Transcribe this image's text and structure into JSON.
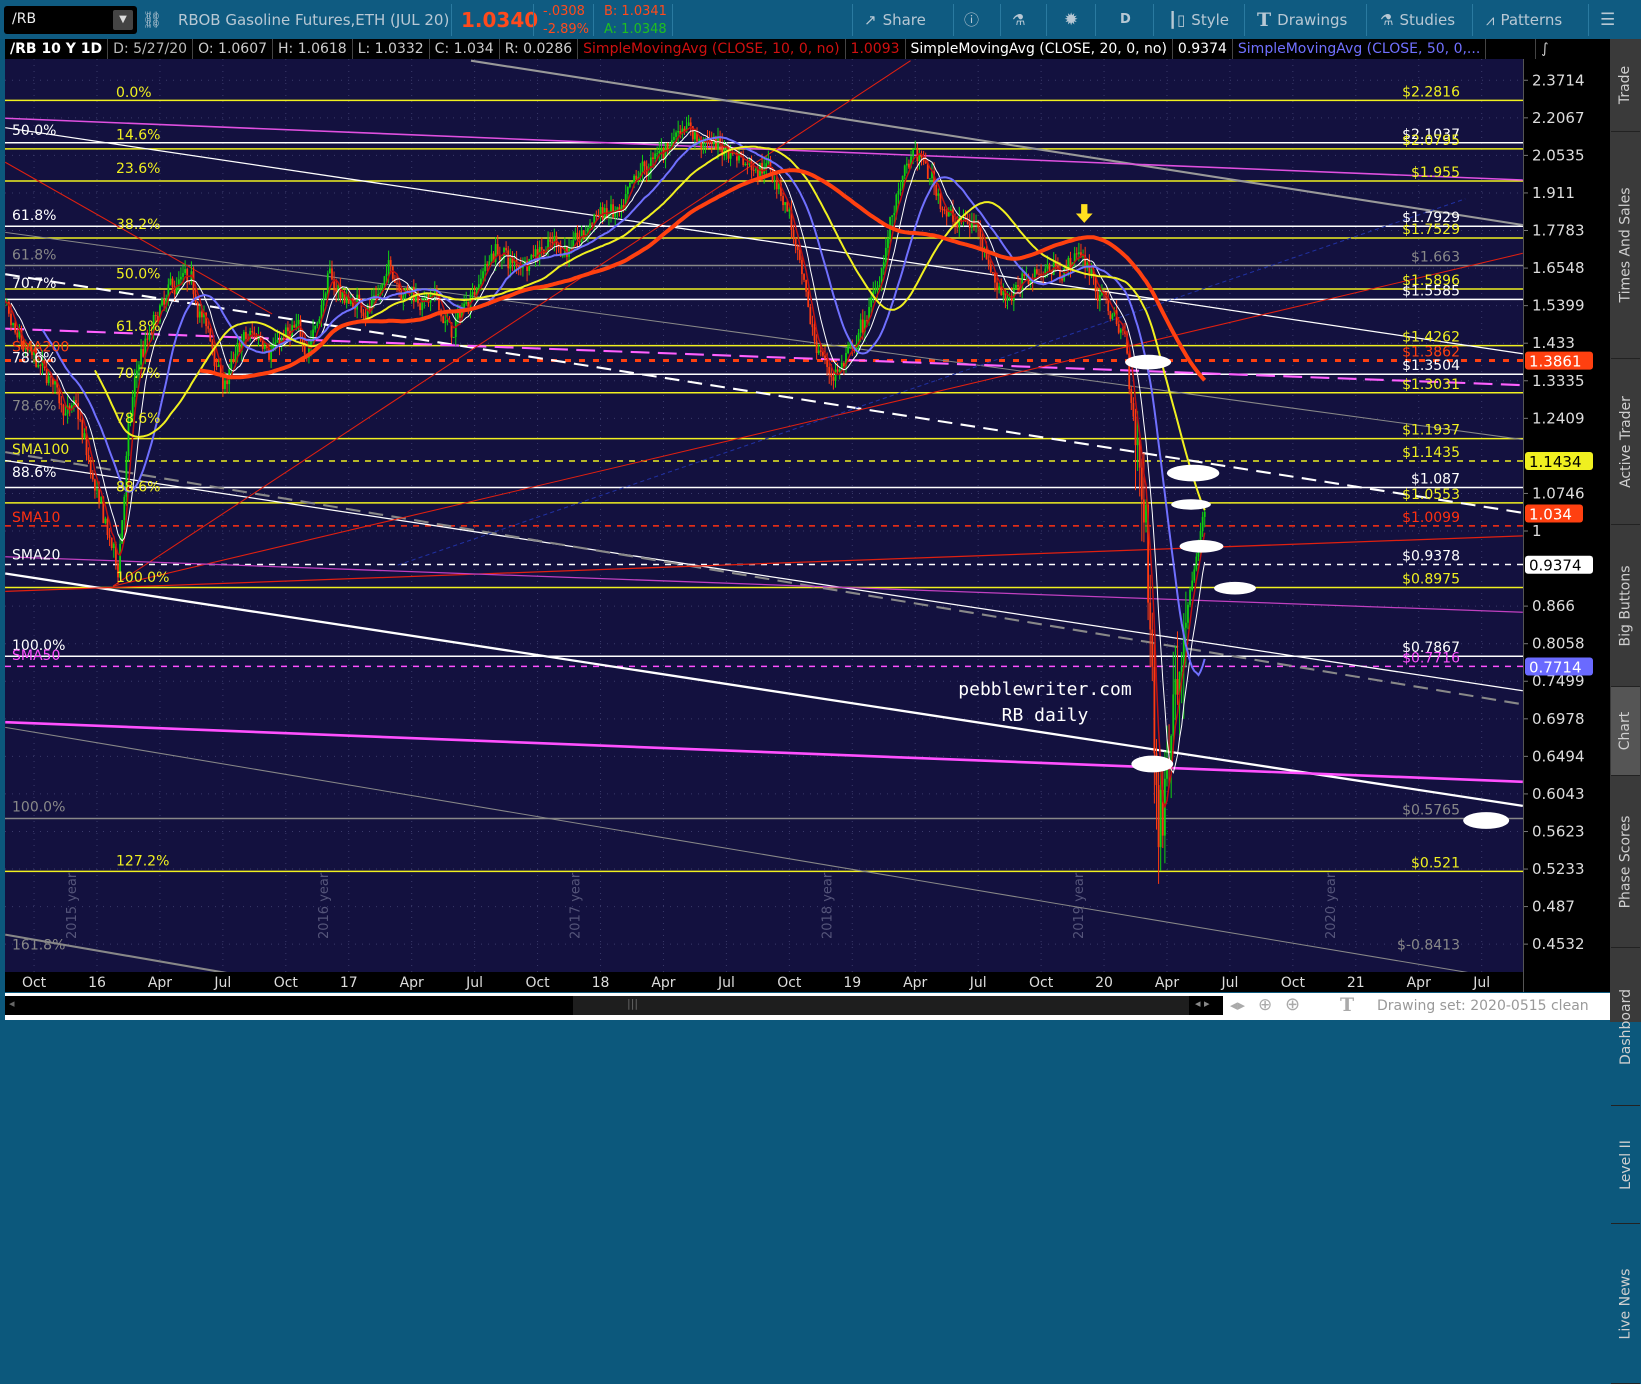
{
  "toolbar": {
    "symbol": "/RB",
    "description": "RBOB Gasoline Futures,ETH (JUL 20)",
    "last": "1.0340",
    "change": "-.0308",
    "change_pct": "-2.89%",
    "bid": "B: 1.0341",
    "ask": "A: 1.0348",
    "share": "Share",
    "aggregation": "D",
    "style": "Style",
    "drawings": "Drawings",
    "studies": "Studies",
    "patterns": "Patterns",
    "colors": {
      "bar": "#0f5b81",
      "last": "#ff4a1c",
      "bid": "#ff4a1c",
      "ask": "#1fc01f"
    }
  },
  "header": {
    "title": "/RB 10 Y 1D",
    "date": "D: 5/27/20",
    "open": "O: 1.0607",
    "high": "H: 1.0618",
    "low": "L: 1.0332",
    "close": "C: 1.034",
    "range": "R: 0.0286",
    "studies": [
      {
        "label": "SimpleMovingAvg (CLOSE, 10, 0, no)",
        "value": "1.0093",
        "color": "#d01010"
      },
      {
        "label": "SimpleMovingAvg (CLOSE, 20, 0, no)",
        "value": "0.9374",
        "color": "#ffffff"
      },
      {
        "label": "SimpleMovingAvg (CLOSE, 50, 0,...",
        "value": "",
        "color": "#7070ff"
      }
    ]
  },
  "sidebar": {
    "tabs": [
      "Trade",
      "Times And Sales",
      "Active Trader",
      "Big Buttons",
      "Chart",
      "Phase Scores",
      "Dashboard",
      "Level II",
      "Live News"
    ],
    "selected": "Chart"
  },
  "chart_data": {
    "type": "candlestick",
    "title": "/RB 10 Y 1D",
    "scale": "log",
    "ylim": [
      0.43,
      2.45
    ],
    "y_ticks": [
      "2.3714",
      "2.2067",
      "2.0535",
      "1.911",
      "1.7783",
      "1.6548",
      "1.5399",
      "1.433",
      "1.3335",
      "1.2409",
      "1.0746",
      "1",
      "0.866",
      "0.8058",
      "0.7499",
      "0.6978",
      "0.6494",
      "0.6043",
      "0.5623",
      "0.5233",
      "0.487",
      "0.4532"
    ],
    "x_ticks": [
      [
        "Oct",
        -3
      ],
      [
        "16",
        0
      ],
      [
        "Apr",
        3
      ],
      [
        "Jul",
        6
      ],
      [
        "Oct",
        9
      ],
      [
        "17",
        12
      ],
      [
        "Apr",
        15
      ],
      [
        "Jul",
        18
      ],
      [
        "Oct",
        21
      ],
      [
        "18",
        24
      ],
      [
        "Apr",
        27
      ],
      [
        "Jul",
        30
      ],
      [
        "Oct",
        33
      ],
      [
        "19",
        36
      ],
      [
        "Apr",
        39
      ],
      [
        "Jul",
        42
      ],
      [
        "Oct",
        45
      ],
      [
        "20",
        48
      ],
      [
        "Apr",
        51
      ],
      [
        "Jul",
        54
      ],
      [
        "Oct",
        57
      ],
      [
        "21",
        60
      ],
      [
        "Apr",
        63
      ],
      [
        "Jul",
        66
      ]
    ],
    "year_watermarks": [
      [
        "2015 year",
        -1
      ],
      [
        "2016 year",
        11
      ],
      [
        "2017 year",
        23
      ],
      [
        "2018 year",
        35
      ],
      [
        "2019 year",
        47
      ],
      [
        "2020 year",
        59
      ]
    ],
    "monthly_close_approx": {
      "months_from_jan2016": [
        -5,
        -4,
        -3,
        -2,
        -1,
        0,
        1,
        1.5,
        2,
        3,
        4,
        5,
        6,
        7,
        8,
        9,
        10,
        11,
        12,
        13,
        14,
        15,
        16,
        17,
        18,
        19,
        20,
        21,
        22,
        23,
        24,
        25,
        26,
        27,
        28,
        29,
        30,
        31,
        32,
        33,
        34,
        35,
        36,
        37,
        38,
        39,
        40,
        41,
        42,
        43,
        44,
        45,
        46,
        47,
        48,
        49,
        50,
        50.6,
        51,
        52,
        52.9
      ],
      "close": [
        1.6,
        1.42,
        1.35,
        1.3,
        1.25,
        1.05,
        0.92,
        1.2,
        1.38,
        1.5,
        1.6,
        1.5,
        1.32,
        1.42,
        1.45,
        1.45,
        1.42,
        1.62,
        1.55,
        1.55,
        1.65,
        1.6,
        1.55,
        1.45,
        1.62,
        1.72,
        1.65,
        1.75,
        1.75,
        1.72,
        1.85,
        1.8,
        1.95,
        2.05,
        2.22,
        2.1,
        2.08,
        2.05,
        2.05,
        1.85,
        1.45,
        1.35,
        1.4,
        1.55,
        1.85,
        2.05,
        1.92,
        1.8,
        1.8,
        1.6,
        1.6,
        1.65,
        1.67,
        1.7,
        1.55,
        1.45,
        1.0,
        0.55,
        0.65,
        0.9,
        1.034
      ]
    },
    "moving_averages": [
      {
        "name": "SMA10",
        "period": 10,
        "color": "#c01010"
      },
      {
        "name": "SMA20",
        "period": 20,
        "color": "#ffffff"
      },
      {
        "name": "SMA50",
        "period": 50,
        "color": "#7070ff"
      },
      {
        "name": "SMA100",
        "period": 100,
        "color": "#f0f020"
      },
      {
        "name": "SMA200",
        "period": 200,
        "color": "#ff4010"
      }
    ],
    "price_tags": [
      {
        "value": "1.3861",
        "color": "#ff4010",
        "text": "#fff"
      },
      {
        "value": "1.1434",
        "color": "#f0f020",
        "text": "#000"
      },
      {
        "value": "1.034",
        "color": "#ff4010",
        "text": "#fff"
      },
      {
        "value": "0.9374",
        "color": "#ffffff",
        "text": "#000"
      },
      {
        "value": "0.7714",
        "color": "#6a6aff",
        "text": "#fff"
      }
    ],
    "level_labels": [
      {
        "text": "$2.2816",
        "price": 2.2816,
        "color": "#f0f020",
        "line": "solid"
      },
      {
        "text": "$2.1037",
        "price": 2.1037,
        "color": "#ffffff",
        "line": "solid"
      },
      {
        "text": "$2.0795",
        "price": 2.0795,
        "color": "#f0f020",
        "line": "solid"
      },
      {
        "text": "$1.955",
        "price": 1.955,
        "color": "#f0f020",
        "line": "solid"
      },
      {
        "text": "$1.7929",
        "price": 1.7929,
        "color": "#ffffff",
        "line": "solid"
      },
      {
        "text": "$1.7529",
        "price": 1.7529,
        "color": "#f0f020",
        "line": "solid"
      },
      {
        "text": "$1.663",
        "price": 1.663,
        "color": "#888888",
        "line": "solid"
      },
      {
        "text": "$1.5896",
        "price": 1.5896,
        "color": "#f0f020",
        "line": "solid"
      },
      {
        "text": "$1.5585",
        "price": 1.5585,
        "color": "#ffffff",
        "line": "solid"
      },
      {
        "text": "$1.4262",
        "price": 1.4262,
        "color": "#f0f020",
        "line": "solid"
      },
      {
        "text": "$1.3862",
        "price": 1.3862,
        "color": "#ff4010",
        "line": "dotted"
      },
      {
        "text": "$1.3504",
        "price": 1.3504,
        "color": "#ffffff",
        "line": "solid"
      },
      {
        "text": "$1.3031",
        "price": 1.3031,
        "color": "#f0f020",
        "line": "solid"
      },
      {
        "text": "$1.1937",
        "price": 1.1937,
        "color": "#f0f020",
        "line": "solid"
      },
      {
        "text": "$1.1435",
        "price": 1.1435,
        "color": "#f0f020",
        "line": "dashed"
      },
      {
        "text": "$1.087",
        "price": 1.087,
        "color": "#ffffff",
        "line": "solid"
      },
      {
        "text": "$1.0553",
        "price": 1.0553,
        "color": "#f0f020",
        "line": "solid"
      },
      {
        "text": "$1.0099",
        "price": 1.0099,
        "color": "#ff3010",
        "line": "dashed"
      },
      {
        "text": "$0.9378",
        "price": 0.9378,
        "color": "#ffffff",
        "line": "dashed"
      },
      {
        "text": "$0.8975",
        "price": 0.8975,
        "color": "#f0f020",
        "line": "solid"
      },
      {
        "text": "$0.7867",
        "price": 0.7867,
        "color": "#ffffff",
        "line": "solid"
      },
      {
        "text": "$0.7716",
        "price": 0.7716,
        "color": "#ff50ff",
        "line": "dashed"
      },
      {
        "text": "$0.5765",
        "price": 0.5765,
        "color": "#888888",
        "line": "solid"
      },
      {
        "text": "$0.521",
        "price": 0.521,
        "color": "#f0f020",
        "line": "solid"
      },
      {
        "text": "$-0.8413",
        "price": 0.445,
        "color": "#888888",
        "line": "none"
      }
    ],
    "fib_left_white": [
      [
        "50.0%",
        2.12,
        "#fff"
      ],
      [
        "61.8%",
        1.8,
        "#fff"
      ],
      [
        "61.8%",
        1.67,
        "#888"
      ],
      [
        "70.7%",
        1.58,
        "#fff"
      ],
      [
        "78.6%",
        1.37,
        "#fff"
      ],
      [
        "78.6%",
        1.25,
        "#888"
      ],
      [
        "88.6%",
        1.1,
        "#fff"
      ],
      [
        "100.0%",
        0.79,
        "#fff"
      ],
      [
        "100.0%",
        0.58,
        "#888"
      ],
      [
        "161.8%",
        0.445,
        "#888"
      ]
    ],
    "fib_left_yellow": [
      [
        "0.0%",
        2.28
      ],
      [
        "14.6%",
        2.1
      ],
      [
        "23.6%",
        1.97
      ],
      [
        "38.2%",
        1.77
      ],
      [
        "50.0%",
        1.61
      ],
      [
        "61.8%",
        1.455
      ],
      [
        "70.7%",
        1.33
      ],
      [
        "78.6%",
        1.22
      ],
      [
        "88.6%",
        1.07
      ],
      [
        "100.0%",
        0.9
      ],
      [
        "127.2%",
        0.523
      ]
    ],
    "sma_tags": [
      [
        "SMA200",
        1.4,
        "#ff4010"
      ],
      [
        "SMA100",
        1.15,
        "#f0f020"
      ],
      [
        "SMA10",
        1.01,
        "#ff3010"
      ],
      [
        "SMA20",
        0.94,
        "#ffffff"
      ],
      [
        "SMA50",
        0.775,
        "#ff50ff"
      ]
    ],
    "annotation": [
      "pebblewriter.com",
      "RB daily"
    ]
  },
  "statusbar": {
    "drawing_set": "Drawing set: 2020-0515 clean"
  }
}
